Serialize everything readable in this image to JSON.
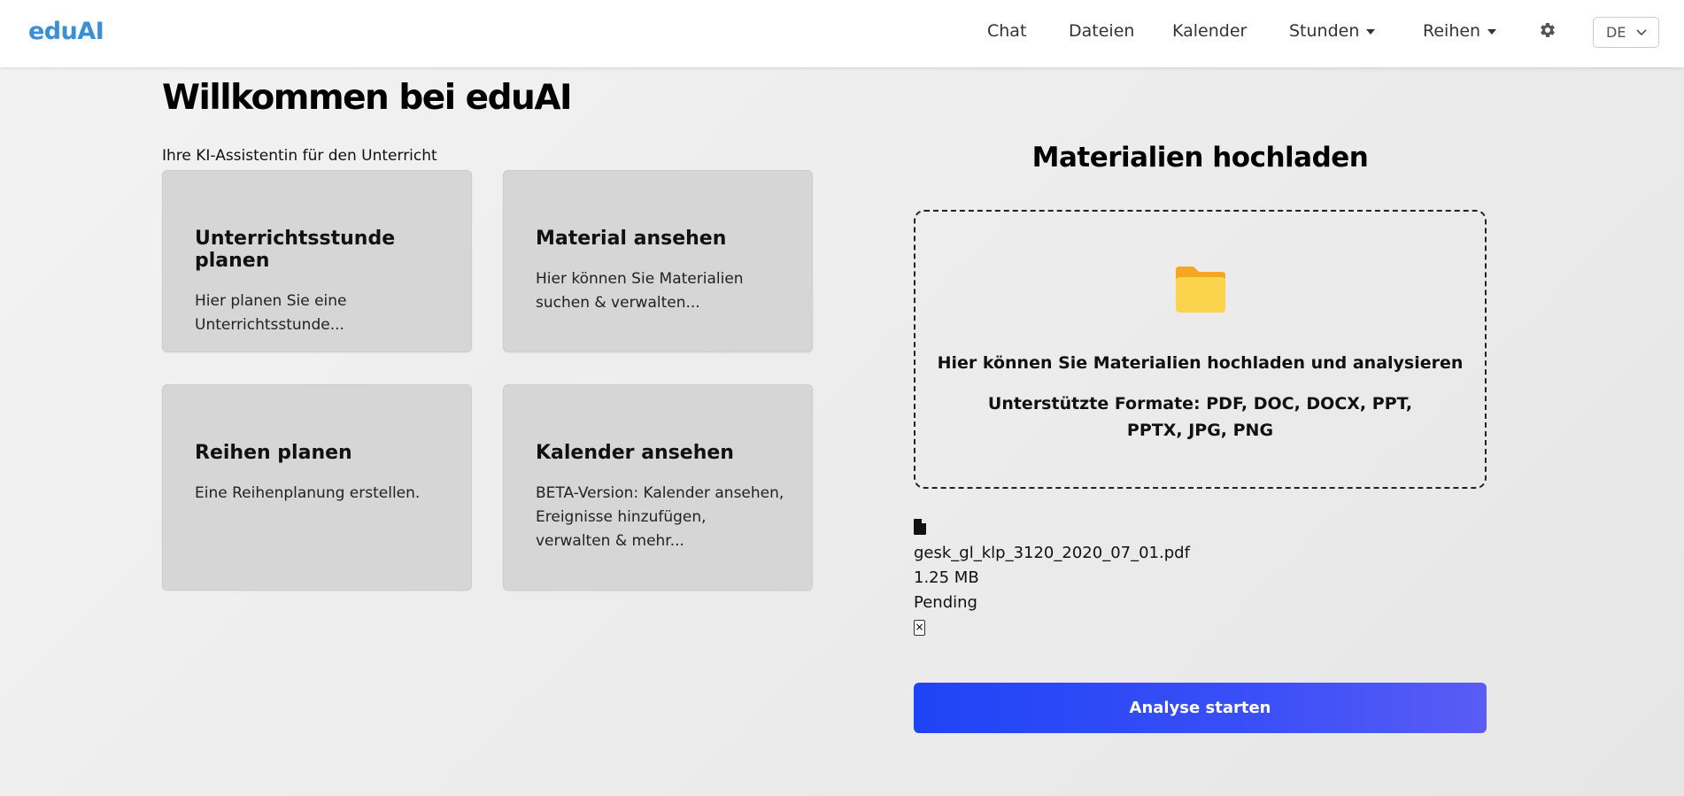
{
  "brand": "eduAI",
  "nav": {
    "chat": "Chat",
    "files": "Dateien",
    "calendar": "Kalender",
    "lessons": "Stunden",
    "series": "Reihen",
    "language": "DE"
  },
  "main": {
    "title": "Willkommen bei eduAI",
    "subtitle": "Ihre KI-Assistentin für den Unterricht",
    "cards": [
      {
        "title": "Unterrichtsstunde planen",
        "desc": "Hier planen Sie eine Unterrichtsstunde..."
      },
      {
        "title": "Material ansehen",
        "desc": "Hier können Sie Materialien suchen & verwalten..."
      },
      {
        "title": "Reihen planen",
        "desc": "Eine Reihenplanung erstellen."
      },
      {
        "title": "Kalender ansehen",
        "desc": "BETA-Version: Kalender ansehen, Ereignisse hinzufügen, verwalten & mehr..."
      }
    ]
  },
  "upload": {
    "title": "Materialien hochladen",
    "instruction": "Hier können Sie Materialien hochladen und analysieren",
    "formats": "Unterstützte Formate: PDF, DOC, DOCX, PPT, PPTX, JPG, PNG",
    "file": {
      "name": "gesk_gl_klp_3120_2020_07_01.pdf",
      "size": "1.25 MB",
      "status": "Pending",
      "remove": "×"
    },
    "analyze_label": "Analyse starten"
  },
  "colors": {
    "brand": "#3a8fd6",
    "button_start": "#1f44f5",
    "button_end": "#5a5cf5",
    "folder": "#fcd34d"
  },
  "icons": [
    "gear-icon",
    "chevron-down-icon",
    "folder-icon",
    "file-icon"
  ]
}
